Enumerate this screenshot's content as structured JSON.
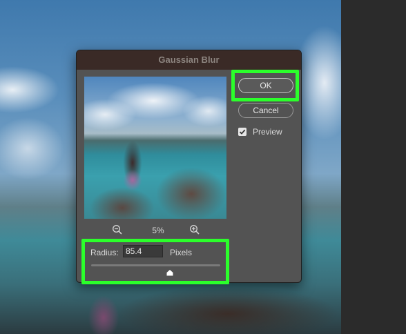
{
  "dialog": {
    "title": "Gaussian Blur",
    "ok_label": "OK",
    "cancel_label": "Cancel",
    "preview_label": "Preview",
    "preview_checked": true,
    "zoom": "5%",
    "radius_label": "Radius:",
    "radius_value": "85.4",
    "radius_unit": "Pixels",
    "radius_slider_fraction": 0.61
  },
  "icons": {
    "zoom_out": "zoom-out-icon",
    "zoom_in": "zoom-in-icon",
    "check": "checkmark-icon",
    "slider_thumb": "slider-thumb-icon"
  },
  "highlight_color": "#2bff2b"
}
